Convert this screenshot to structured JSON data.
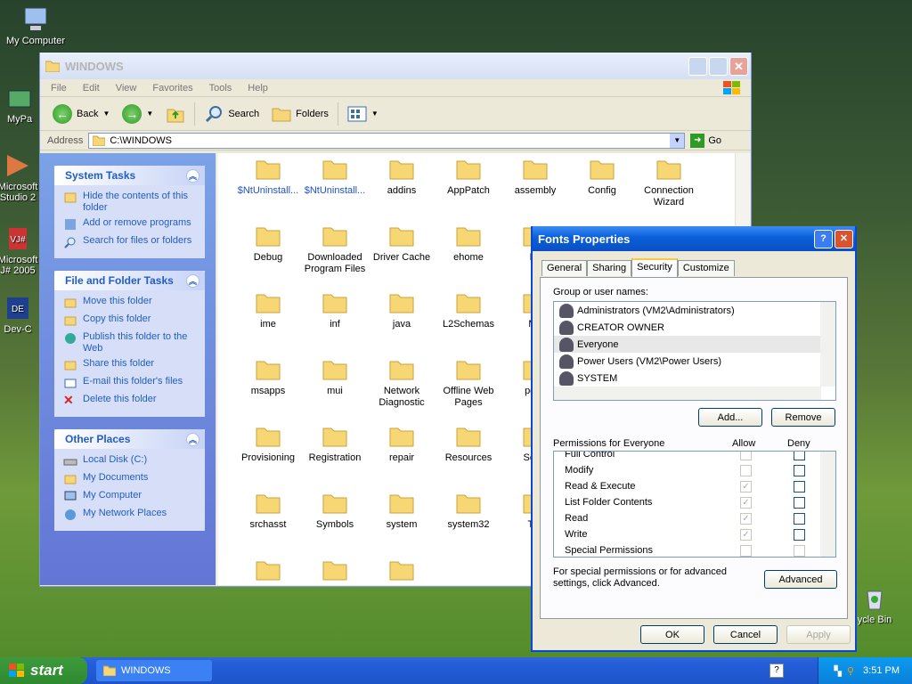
{
  "desktop": {
    "icons": [
      {
        "label": "My Computer"
      },
      {
        "label": "MyPa"
      },
      {
        "label": "Microsoft Studio 2"
      },
      {
        "label": "Microsoft J# 2005"
      },
      {
        "label": "Dev-C"
      },
      {
        "label": "ycle Bin"
      }
    ]
  },
  "explorer": {
    "title": "WINDOWS",
    "menu": [
      "File",
      "Edit",
      "View",
      "Favorites",
      "Tools",
      "Help"
    ],
    "toolbar": {
      "back": "Back",
      "search": "Search",
      "folders": "Folders"
    },
    "address": {
      "label": "Address",
      "value": "C:\\WINDOWS",
      "go": "Go"
    },
    "panels": [
      {
        "title": "System Tasks",
        "items": [
          "Hide the contents of this folder",
          "Add or remove programs",
          "Search for files or folders"
        ]
      },
      {
        "title": "File and Folder Tasks",
        "items": [
          "Move this folder",
          "Copy this folder",
          "Publish this folder to the Web",
          "Share this folder",
          "E-mail this folder's files",
          "Delete this folder"
        ]
      },
      {
        "title": "Other Places",
        "items": [
          "Local Disk (C:)",
          "My Documents",
          "My Computer",
          "My Network Places"
        ]
      }
    ],
    "folders": [
      [
        "$NtUninstall...",
        "$NtUninstall...",
        "addins",
        "AppPatch",
        "assembly",
        "Config",
        "Connection Wizard"
      ],
      [
        "Debug",
        "Downloaded Program Files",
        "Driver Cache",
        "ehome",
        "Fo"
      ],
      [
        "ime",
        "inf",
        "java",
        "L2Schemas",
        "Me"
      ],
      [
        "msapps",
        "mui",
        "Network Diagnostic",
        "Offline Web Pages",
        "pche"
      ],
      [
        "Provisioning",
        "Registration",
        "repair",
        "Resources",
        "SchC"
      ],
      [
        "srchasst",
        "Symbols",
        "system",
        "system32",
        "Tas"
      ]
    ]
  },
  "dialog": {
    "title": "Fonts Properties",
    "tabs": [
      "General",
      "Sharing",
      "Security",
      "Customize"
    ],
    "active_tab": "Security",
    "group_label": "Group or user names:",
    "users": [
      "Administrators (VM2\\Administrators)",
      "CREATOR OWNER",
      "Everyone",
      "Power Users (VM2\\Power Users)",
      "SYSTEM"
    ],
    "selected_user": "Everyone",
    "add_button": "Add...",
    "remove_button": "Remove",
    "perm_label": "Permissions for Everyone",
    "allow_label": "Allow",
    "deny_label": "Deny",
    "permissions": [
      {
        "name": "Full Control",
        "allow": false,
        "deny": false
      },
      {
        "name": "Modify",
        "allow": false,
        "deny": false
      },
      {
        "name": "Read & Execute",
        "allow": true,
        "deny": false
      },
      {
        "name": "List Folder Contents",
        "allow": true,
        "deny": false
      },
      {
        "name": "Read",
        "allow": true,
        "deny": false
      },
      {
        "name": "Write",
        "allow": true,
        "deny": false
      },
      {
        "name": "Special Permissions",
        "allow": false,
        "deny": false
      }
    ],
    "advanced_text": "For special permissions or for advanced settings, click Advanced.",
    "advanced_button": "Advanced",
    "ok": "OK",
    "cancel": "Cancel",
    "apply": "Apply"
  },
  "taskbar": {
    "start": "start",
    "task": "WINDOWS",
    "clock": "3:51 PM"
  },
  "colors": {
    "accent": "#215dc6",
    "title_active": "#0a5fd8",
    "taskbar": "#245edb",
    "start": "#2f8a2f"
  }
}
